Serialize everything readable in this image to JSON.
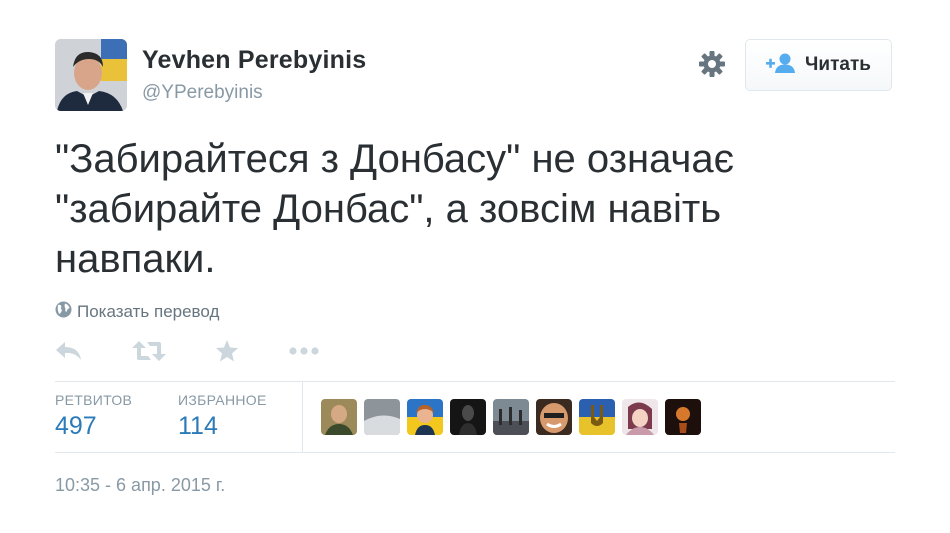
{
  "user": {
    "name": "Yevhen Perebyinis",
    "handle": "@YPerebyinis"
  },
  "follow": {
    "label": "Читать",
    "icon": "add-user-icon"
  },
  "settings": {
    "icon": "gear-icon"
  },
  "tweet": {
    "text": "\"Забирайтеся з Донбасу\" не означає\n\"забирайте Донбас\", а зовсім навіть\nнавпаки."
  },
  "translate": {
    "label": "Показать перевод",
    "icon": "globe-icon"
  },
  "actions": [
    {
      "name": "reply",
      "icon": "reply-icon"
    },
    {
      "name": "retweet",
      "icon": "retweet-icon"
    },
    {
      "name": "favorite",
      "icon": "star-icon"
    },
    {
      "name": "more",
      "icon": "more-icon"
    }
  ],
  "stats": {
    "retweets": {
      "label": "РЕТВИТОВ",
      "value": "497"
    },
    "favorites": {
      "label": "ИЗБРАННОЕ",
      "value": "114"
    }
  },
  "timestamp": "10:35 - 6 апр. 2015 г.",
  "colors": {
    "link": "#2b7bb9",
    "muted": "#8899a6",
    "text": "#292f33",
    "icon": "#ccd6dd",
    "border": "#e1e8ed"
  }
}
